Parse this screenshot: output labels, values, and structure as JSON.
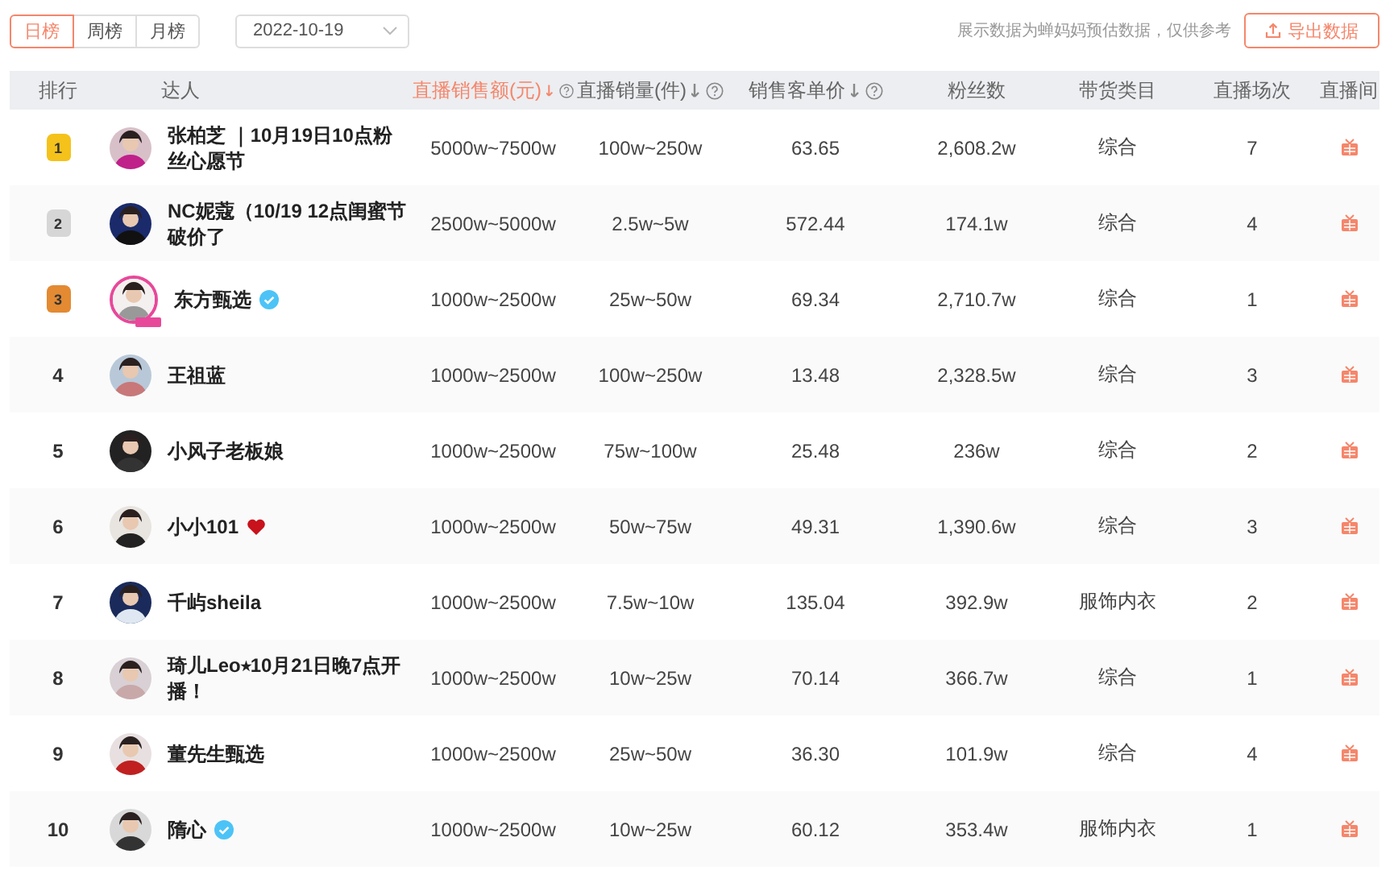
{
  "tabs": [
    {
      "label": "日榜",
      "selected": true
    },
    {
      "label": "周榜",
      "selected": false
    },
    {
      "label": "月榜",
      "selected": false
    }
  ],
  "date_select": {
    "value": "2022-10-19"
  },
  "note": "展示数据为蝉妈妈预估数据，仅供参考",
  "export_button": {
    "label": "导出数据"
  },
  "table": {
    "columns": [
      {
        "label": "排行",
        "sortable": false,
        "help": false,
        "selected": false
      },
      {
        "label": "达人",
        "sortable": false,
        "help": false,
        "selected": false
      },
      {
        "label": "直播销售额(元)",
        "sortable": true,
        "help": true,
        "selected": true
      },
      {
        "label": "直播销量(件)",
        "sortable": true,
        "help": true,
        "selected": false
      },
      {
        "label": "销售客单价",
        "sortable": true,
        "help": true,
        "selected": false
      },
      {
        "label": "粉丝数",
        "sortable": false,
        "help": false,
        "selected": false
      },
      {
        "label": "带货类目",
        "sortable": false,
        "help": false,
        "selected": false
      },
      {
        "label": "直播场次",
        "sortable": false,
        "help": false,
        "selected": false
      },
      {
        "label": "直播间",
        "sortable": false,
        "help": false,
        "selected": false
      }
    ],
    "rows": [
      {
        "rank": "1",
        "kind": "medal",
        "color": "#f4c21b",
        "name": "张柏芝 ｜10月19日10点粉丝心愿节",
        "verified": false,
        "heart": false,
        "live": false,
        "sales": "5000w~7500w",
        "volume": "100w~250w",
        "price": "63.65",
        "fans": "2,608.2w",
        "category": "综合",
        "sessions": "7"
      },
      {
        "rank": "2",
        "kind": "medal",
        "color": "#d6d6d6",
        "name": "NC妮蔻（10/19 12点闺蜜节破价了",
        "verified": false,
        "heart": false,
        "live": false,
        "sales": "2500w~5000w",
        "volume": "2.5w~5w",
        "price": "572.44",
        "fans": "174.1w",
        "category": "综合",
        "sessions": "4"
      },
      {
        "rank": "3",
        "kind": "medal",
        "color": "#e38a32",
        "name": "东方甄选",
        "verified": true,
        "heart": false,
        "live": true,
        "sales": "1000w~2500w",
        "volume": "25w~50w",
        "price": "69.34",
        "fans": "2,710.7w",
        "category": "综合",
        "sessions": "1"
      },
      {
        "rank": "4",
        "kind": "number",
        "name": "王祖蓝",
        "verified": false,
        "heart": false,
        "live": false,
        "sales": "1000w~2500w",
        "volume": "100w~250w",
        "price": "13.48",
        "fans": "2,328.5w",
        "category": "综合",
        "sessions": "3"
      },
      {
        "rank": "5",
        "kind": "number",
        "name": "小风子老板娘",
        "verified": false,
        "heart": false,
        "live": false,
        "sales": "1000w~2500w",
        "volume": "75w~100w",
        "price": "25.48",
        "fans": "236w",
        "category": "综合",
        "sessions": "2"
      },
      {
        "rank": "6",
        "kind": "number",
        "name": "小小101",
        "verified": false,
        "heart": true,
        "live": false,
        "sales": "1000w~2500w",
        "volume": "50w~75w",
        "price": "49.31",
        "fans": "1,390.6w",
        "category": "综合",
        "sessions": "3"
      },
      {
        "rank": "7",
        "kind": "number",
        "name": "千屿sheila",
        "verified": false,
        "heart": false,
        "live": false,
        "sales": "1000w~2500w",
        "volume": "7.5w~10w",
        "price": "135.04",
        "fans": "392.9w",
        "category": "服饰内衣",
        "sessions": "2"
      },
      {
        "rank": "8",
        "kind": "number",
        "name": "琦儿Leo⭑10月21日晚7点开播！",
        "verified": false,
        "heart": false,
        "live": false,
        "sales": "1000w~2500w",
        "volume": "10w~25w",
        "price": "70.14",
        "fans": "366.7w",
        "category": "综合",
        "sessions": "1"
      },
      {
        "rank": "9",
        "kind": "number",
        "name": "董先生甄选",
        "verified": false,
        "heart": false,
        "live": false,
        "sales": "1000w~2500w",
        "volume": "25w~50w",
        "price": "36.30",
        "fans": "101.9w",
        "category": "综合",
        "sessions": "4"
      },
      {
        "rank": "10",
        "kind": "number",
        "name": "隋心",
        "verified": true,
        "heart": false,
        "live": false,
        "sales": "1000w~2500w",
        "volume": "10w~25w",
        "price": "60.12",
        "fans": "353.4w",
        "category": "服饰内衣",
        "sessions": "1"
      }
    ]
  }
}
